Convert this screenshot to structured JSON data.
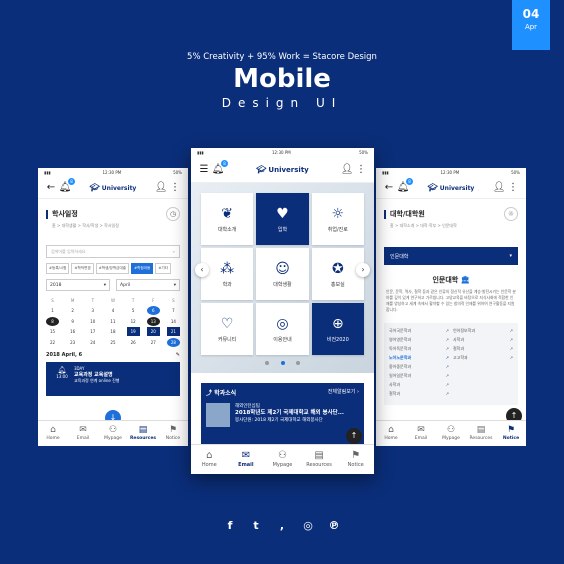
{
  "badge": {
    "day": "04",
    "month": "Apr"
  },
  "header": {
    "tagline": "5% Creativity + 95% Work = Stacore Design",
    "title": "Mobile",
    "subtitle": "Design UI"
  },
  "status": {
    "time": "12:30 PM",
    "battery": "50%"
  },
  "brand": "University",
  "notif_count": "8",
  "left": {
    "title": "학사일정",
    "breadcrumb": "홈 > 대학생활 > 학사/학생 > 학사일정",
    "search_placeholder": "검색어를 입력하세요",
    "chips": [
      "#등록/시험",
      "#학적변경",
      "#학생/장학금대출",
      "#학점이동",
      "#기타"
    ],
    "year": "2018",
    "month": "April",
    "weekdays": [
      "S",
      "M",
      "T",
      "W",
      "T",
      "F",
      "S"
    ],
    "weeks": [
      [
        "1",
        "2",
        "3",
        "4",
        "5",
        "6",
        "7"
      ],
      [
        "8",
        "9",
        "10",
        "11",
        "12",
        "13",
        "14"
      ],
      [
        "15",
        "16",
        "17",
        "18",
        "19",
        "20",
        "21"
      ],
      [
        "22",
        "23",
        "24",
        "25",
        "26",
        "27",
        "28"
      ]
    ],
    "day_label": "2018 April, 6",
    "event": {
      "tag": "3DAY",
      "time": "13:00",
      "title": "교육과정 교육설명",
      "desc": "교육과정 연계 online 진행"
    }
  },
  "center": {
    "grid": [
      {
        "label": "대학소개",
        "icon": "hand-plant-icon"
      },
      {
        "label": "입학",
        "icon": "heart-hands-icon"
      },
      {
        "label": "취업/진로",
        "icon": "lightbulb-icon"
      },
      {
        "label": "학과",
        "icon": "people-icon"
      },
      {
        "label": "대학생활",
        "icon": "person-icon"
      },
      {
        "label": "홍보실",
        "icon": "medal-icon"
      },
      {
        "label": "커뮤니티",
        "icon": "heart-icon"
      },
      {
        "label": "이용안내",
        "icon": "target-icon"
      },
      {
        "label": "비전2020",
        "icon": "globe-icon"
      }
    ],
    "news": {
      "title": "학과소식",
      "more": "전체알림보기",
      "category": "해외인턴십팀",
      "headline": "2018학년도 제2기 국제대학교 해외 봉사단...",
      "desc": "봉사단원: 2018 제2기 국제대학교 해외봉사단"
    }
  },
  "right": {
    "title": "대학/대학원",
    "breadcrumb": "홈 > 대학소개 > 대학·학부 > 인문대학",
    "select": "인문대학",
    "college": "인문대학",
    "desc": "인문, 문학, 역사, 철학 등과 같은 인류의 정신적 유산을 계승·발전시키는 인문학 분야를 깊이 있게 연구하고 가르칩니다. 고양교육을 바탕으로 지식사회에 적합한 인재를 양성하고 세계 속에서 활약할 수 있는 창의적 인재를 위하여 연구활동을 지원합니다.",
    "links_left": [
      "국어국문학과",
      "영어영문학과",
      "독어독문학과",
      "노어노문학과",
      "중어중문학과",
      "일어일문학과",
      "사학과",
      "철학과"
    ],
    "links_right": [
      "언어정보학과",
      "사학과",
      "철학과",
      "고고학과"
    ],
    "active_link": "노어노문학과"
  },
  "tabs": [
    {
      "label": "Home",
      "icon": "home-icon"
    },
    {
      "label": "Email",
      "icon": "mail-icon"
    },
    {
      "label": "Mypage",
      "icon": "people-icon"
    },
    {
      "label": "Resources",
      "icon": "document-icon"
    },
    {
      "label": "Notice",
      "icon": "megaphone-icon"
    }
  ],
  "social": [
    "f",
    "t",
    ",",
    "◎",
    "℗"
  ]
}
